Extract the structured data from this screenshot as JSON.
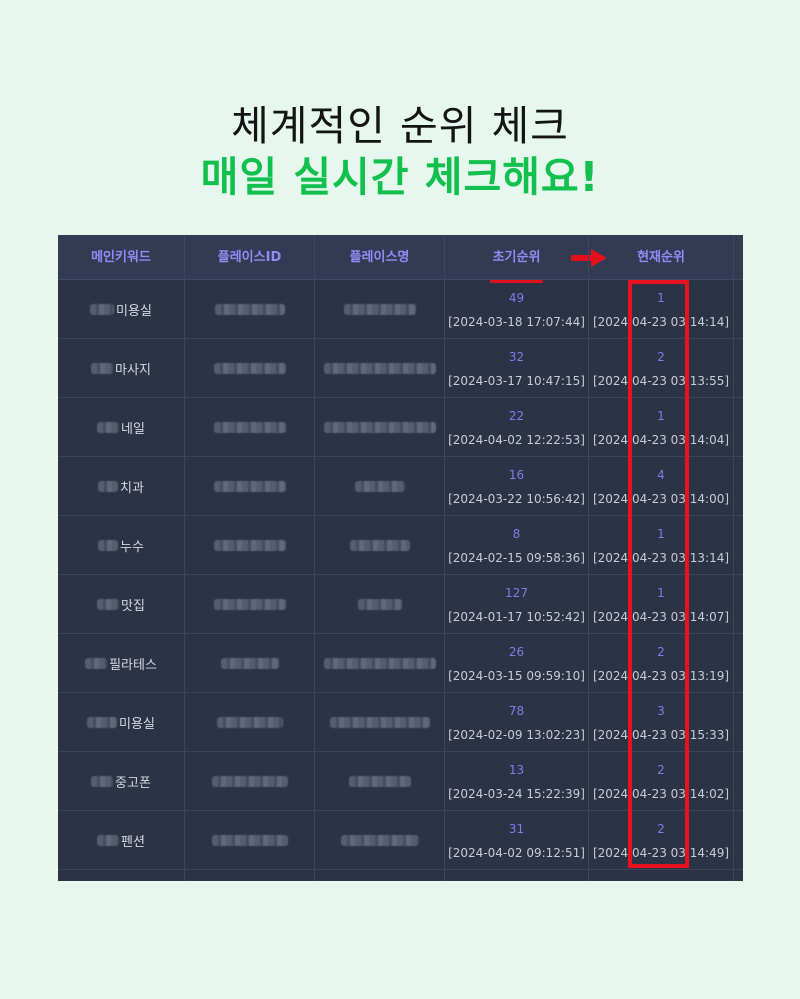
{
  "headline": {
    "line1": "체계적인 순위 체크",
    "line2": "매일 실시간 체크해요!"
  },
  "table": {
    "headers": {
      "keyword": "메인키워드",
      "place_id": "플레이스ID",
      "place_name": "플레이스명",
      "initial_rank": "초기순위",
      "current_rank": "현재순위"
    },
    "rows": [
      {
        "keyword": "미용실",
        "initial_rank": "49",
        "initial_time": "[2024-03-18 17:07:44]",
        "current_rank": "1",
        "current_time": "[2024 04-23 03 14:14]"
      },
      {
        "keyword": "마사지",
        "initial_rank": "32",
        "initial_time": "[2024-03-17 10:47:15]",
        "current_rank": "2",
        "current_time": "[2024 04-23 03 13:55]"
      },
      {
        "keyword": "네일",
        "initial_rank": "22",
        "initial_time": "[2024-04-02 12:22:53]",
        "current_rank": "1",
        "current_time": "[2024 04-23 03 14:04]"
      },
      {
        "keyword": "치과",
        "initial_rank": "16",
        "initial_time": "[2024-03-22 10:56:42]",
        "current_rank": "4",
        "current_time": "[2024 04-23 03 14:00]"
      },
      {
        "keyword": "누수",
        "initial_rank": "8",
        "initial_time": "[2024-02-15 09:58:36]",
        "current_rank": "1",
        "current_time": "[2024 04-23 03 13:14]"
      },
      {
        "keyword": "맛집",
        "initial_rank": "127",
        "initial_time": "[2024-01-17 10:52:42]",
        "current_rank": "1",
        "current_time": "[2024 04-23 03 14:07]"
      },
      {
        "keyword": "필라테스",
        "initial_rank": "26",
        "initial_time": "[2024-03-15 09:59:10]",
        "current_rank": "2",
        "current_time": "[2024 04-23 03 13:19]"
      },
      {
        "keyword": "미용실",
        "initial_rank": "78",
        "initial_time": "[2024-02-09 13:02:23]",
        "current_rank": "3",
        "current_time": "[2024 04-23 03 15:33]"
      },
      {
        "keyword": "중고폰",
        "initial_rank": "13",
        "initial_time": "[2024-03-24 15:22:39]",
        "current_rank": "2",
        "current_time": "[2024 04-23 03 14:02]"
      },
      {
        "keyword": "펜션",
        "initial_rank": "31",
        "initial_time": "[2024-04-02 09:12:51]",
        "current_rank": "2",
        "current_time": "[2024 04-23 03 14:49]"
      }
    ]
  },
  "colors": {
    "page_background": "#e6f7ed",
    "headline_accent": "#12c04e",
    "table_background": "#2c3347",
    "header_text": "#8f8cf6",
    "highlight_red": "#e6121d"
  },
  "icons": {
    "arrow": "right-arrow-icon"
  }
}
